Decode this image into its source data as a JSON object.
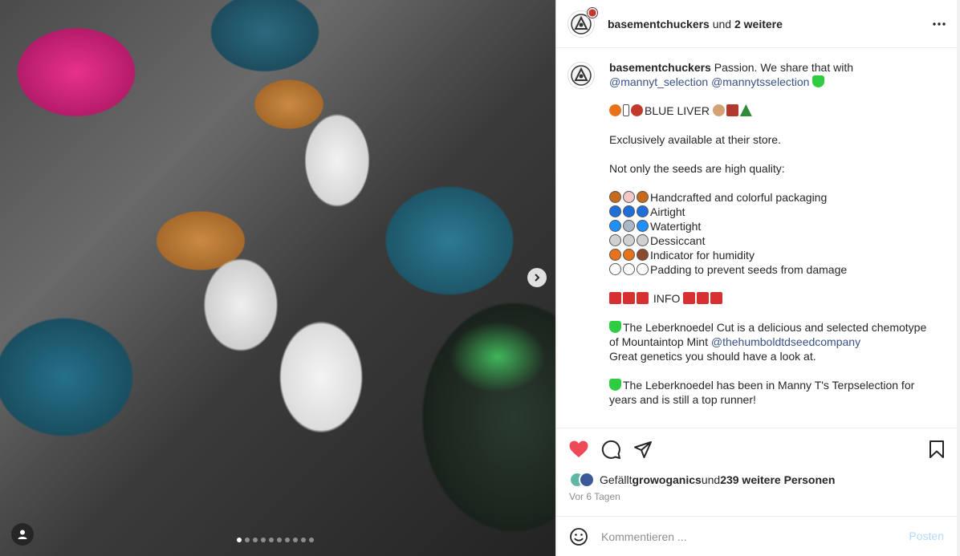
{
  "post": {
    "header": {
      "username": "basementchuckers",
      "and_text": " und ",
      "others": "2 weitere"
    },
    "caption": {
      "username": "basementchuckers",
      "intro": " Passion. We share that with",
      "mention1": "@mannyt_selection",
      "mention2": "@mannytsselection",
      "strain_line": "BLUE LIVER",
      "store_line": "Exclusively available at their store.",
      "quality_line": "Not only the seeds are high quality:",
      "features": [
        {
          "label": "Handcrafted and colorful packaging"
        },
        {
          "label": "Airtight"
        },
        {
          "label": "Watertight"
        },
        {
          "label": "Dessiccant"
        },
        {
          "label": "Indicator for humidity"
        },
        {
          "label": "Padding to prevent seeds from damage"
        }
      ],
      "info_label": " INFO ",
      "p1_text": "The Leberknoedel Cut is a delicious and selected chemotype of Mountaintop Mint ",
      "p1_mention": "@thehumboldtdseedcompany",
      "p1_tail": "Great genetics you should have a look at.",
      "p2_text": "The Leberknoedel has been in Manny T's Terpselection for years and is still a top runner!"
    },
    "likes": {
      "prefix": "Gefällt ",
      "user": "growoganics",
      "middle": " und ",
      "count": "239 weitere Personen"
    },
    "time": "Vor 6 Tagen",
    "comment": {
      "placeholder": "Kommentieren ...",
      "post_label": "Posten"
    },
    "carousel": {
      "count": 10,
      "active_index": 0
    },
    "colors": {
      "like_red": "#ed4956",
      "link_blue": "#385185",
      "heart_green": "#2ecc40"
    }
  }
}
